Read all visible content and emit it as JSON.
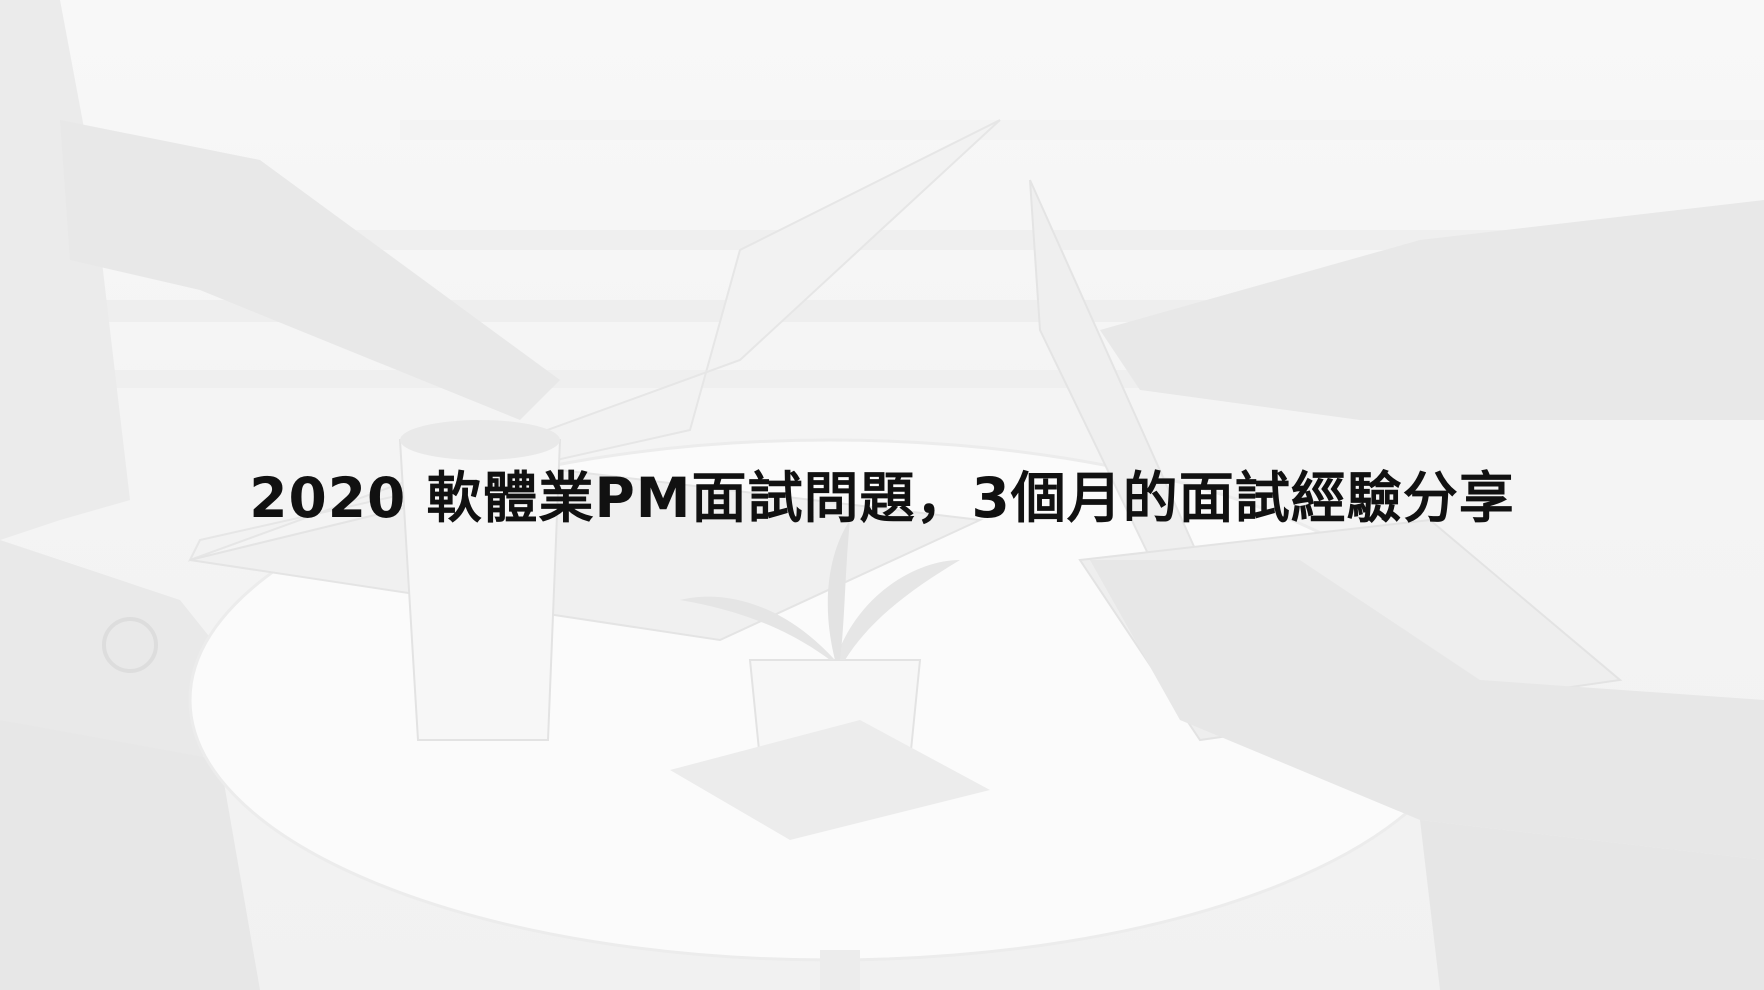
{
  "banner": {
    "title": "2020 軟體業PM面試問題，3個月的面試經驗分享"
  },
  "background": {
    "description_icon": "office-meeting-photo",
    "tint": "#f5f5f5"
  }
}
